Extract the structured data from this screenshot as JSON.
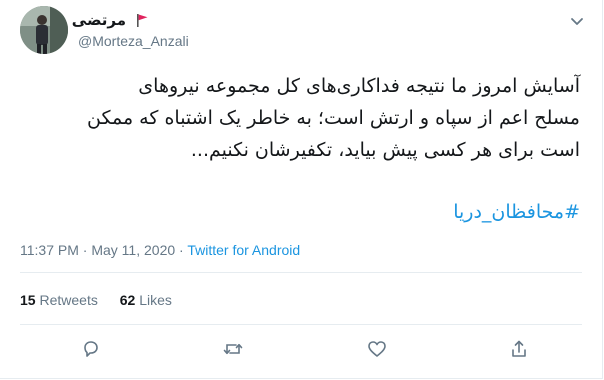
{
  "user": {
    "display_name": "مرتضی",
    "handle": "@Morteza_Anzali"
  },
  "tweet": {
    "lines": [
      "آسایش امروز ما نتیجه فداکاری‌های کل مجموعه نیروهای",
      "مسلح اعم از سپاه و ارتش است؛ به خاطر یک اشتباه که ممکن",
      "است برای هر کسی پیش بیاید، تکفیرشان نکنیم..."
    ],
    "hashtag": "#محافظان_دریا"
  },
  "meta": {
    "time": "11:37 PM",
    "separator1": " · ",
    "date": "May 11, 2020",
    "separator2": " · ",
    "source": "Twitter for Android"
  },
  "stats": {
    "retweets_count": "15",
    "retweets_label": "Retweets",
    "likes_count": "62",
    "likes_label": "Likes"
  },
  "icons": {
    "flag": "red-flag-icon",
    "caret": "chevron-down-icon",
    "reply": "reply-icon",
    "retweet": "retweet-icon",
    "like": "heart-icon",
    "share": "share-icon"
  },
  "colors": {
    "link": "#1b95e0",
    "secondary_text": "#657786",
    "flag": "#e0245e"
  }
}
